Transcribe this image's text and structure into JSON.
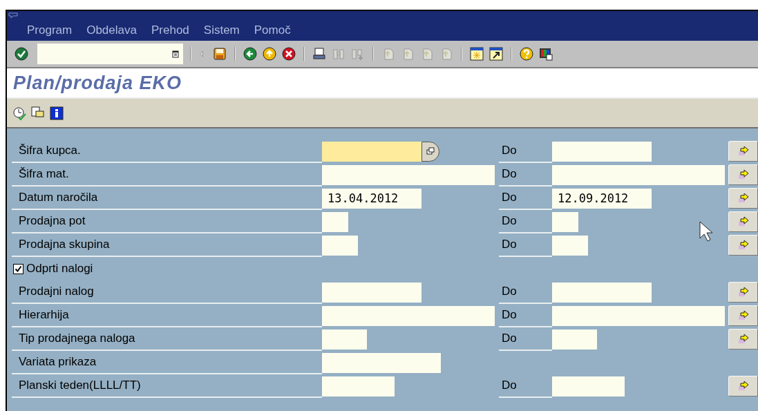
{
  "menu": [
    "Program",
    "Obdelava",
    "Prehod",
    "Sistem",
    "Pomoč"
  ],
  "title": "Plan/prodaja EKO",
  "rows": [
    {
      "kind": "range",
      "label": "Šifra kupca.",
      "from": {
        "focused": true,
        "search_help": true
      },
      "to_label": "Do",
      "to": {}
    },
    {
      "kind": "range",
      "label": "Šifra mat.",
      "from": {
        "focused": false
      },
      "to_label": "Do",
      "to": {}
    },
    {
      "kind": "range",
      "label": "Datum naročila",
      "from": {
        "value": "13.04.2012",
        "focused": false
      },
      "to_label": "Do",
      "to": {
        "value": "12.09.2012"
      }
    },
    {
      "kind": "range",
      "label": "Prodajna pot",
      "from": {
        "focused": false
      },
      "to_label": "Do",
      "to": {}
    },
    {
      "kind": "range",
      "label": "Prodajna skupina",
      "from": {
        "focused": false
      },
      "to_label": "Do",
      "to": {}
    },
    {
      "kind": "checkbox",
      "label": "Odprti nalogi",
      "checked": true
    },
    {
      "kind": "range",
      "label": "Prodajni nalog",
      "from": {
        "focused": false
      },
      "to_label": "Do",
      "to": {}
    },
    {
      "kind": "range",
      "label": "Hierarhija",
      "from": {
        "focused": false
      },
      "to_label": "Do",
      "to": {}
    },
    {
      "kind": "range",
      "label": "Tip prodajnega naloga",
      "from": {
        "focused": false
      },
      "to_label": "Do",
      "to": {}
    },
    {
      "kind": "single",
      "label": "Variata prikaza",
      "from": {
        "focused": false
      }
    },
    {
      "kind": "range",
      "label": "Planski teden(LLLL/TT)",
      "from": {
        "focused": false
      },
      "to_label": "Do",
      "to": {}
    }
  ]
}
